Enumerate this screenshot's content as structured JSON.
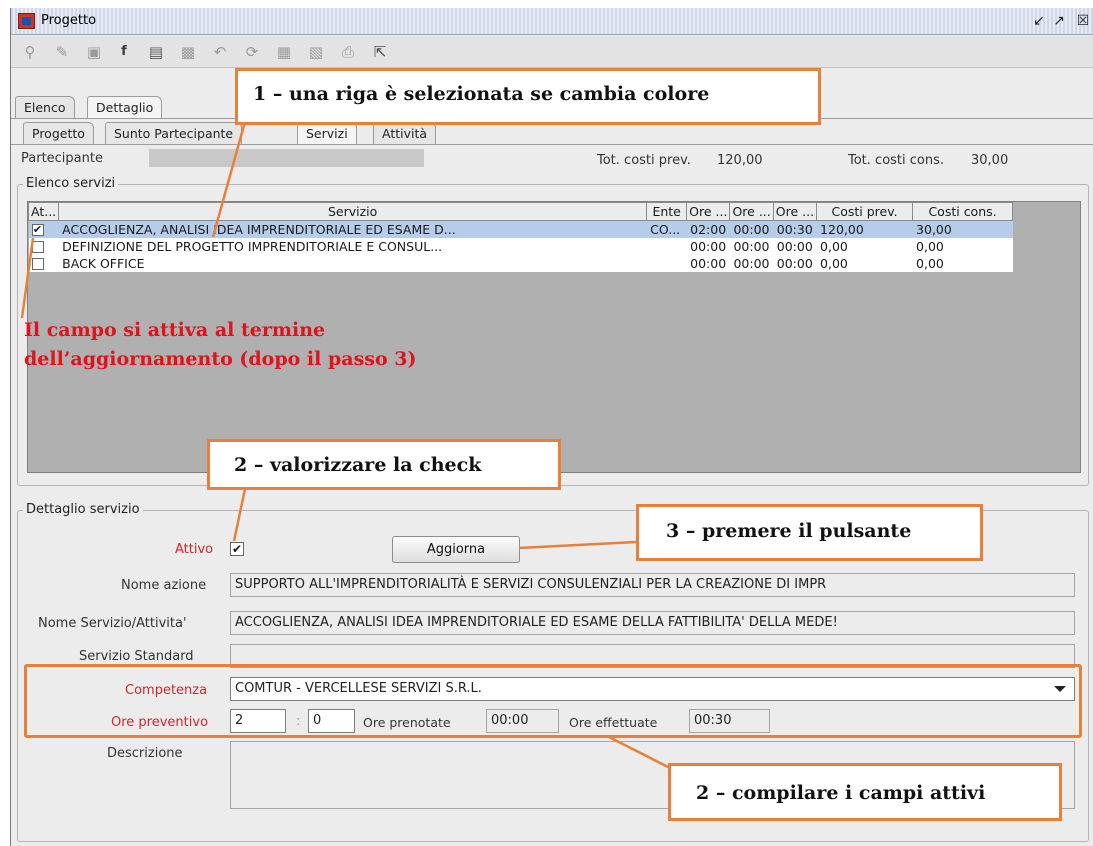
{
  "window": {
    "title": "Progetto",
    "controls": [
      "restore-icon",
      "maximize-icon",
      "close-icon"
    ]
  },
  "toolbar": {
    "icons": [
      "search-icon",
      "edit-icon",
      "document-icon",
      "fo-icon",
      "open-icon",
      "save-icon",
      "undo-icon",
      "refresh-icon",
      "lock-icon",
      "print-preview-icon",
      "print-icon",
      "export-icon"
    ]
  },
  "tabs_main": [
    "Elenco",
    "Dettaglio"
  ],
  "tabs_sub": [
    "Progetto",
    "Sunto Partecipante",
    "Servizi",
    "Attività"
  ],
  "header": {
    "participant_label": "Partecipante",
    "tot_prev_label": "Tot. costi prev.",
    "tot_prev_value": "120,00",
    "tot_cons_label": "Tot. costi cons.",
    "tot_cons_value": "30,00"
  },
  "services_group": {
    "title": "Elenco servizi",
    "columns": [
      "At...",
      "Servizio",
      "Ente",
      "Ore ...",
      "Ore ...",
      "Ore ...",
      "Costi prev.",
      "Costi cons."
    ],
    "rows": [
      {
        "checked": true,
        "servizio": "ACCOGLIENZA, ANALISI IDEA IMPRENDITORIALE ED ESAME D...",
        "ente": "CO...",
        "ore1": "02:00",
        "ore2": "00:00",
        "ore3": "00:30",
        "costi_prev": "120,00",
        "costi_cons": "30,00"
      },
      {
        "checked": false,
        "servizio": "DEFINIZIONE DEL PROGETTO IMPRENDITORIALE E CONSUL...",
        "ente": "",
        "ore1": "00:00",
        "ore2": "00:00",
        "ore3": "00:00",
        "costi_prev": "0,00",
        "costi_cons": "0,00"
      },
      {
        "checked": false,
        "servizio": "BACK OFFICE",
        "ente": "",
        "ore1": "00:00",
        "ore2": "00:00",
        "ore3": "00:00",
        "costi_prev": "0,00",
        "costi_cons": "0,00"
      }
    ]
  },
  "detail_group": {
    "title": "Dettaglio servizio",
    "attivo_label": "Attivo",
    "attivo_checked": true,
    "aggiorna_label": "Aggiorna",
    "nome_azione_label": "Nome azione",
    "nome_azione_value": "SUPPORTO ALL'IMPRENDITORIALITÀ E SERVIZI CONSULENZIALI PER LA CREAZIONE DI IMPR",
    "nome_servizio_label": "Nome Servizio/Attivita'",
    "nome_servizio_value": "ACCOGLIENZA, ANALISI IDEA IMPRENDITORIALE ED ESAME DELLA FATTIBILITA' DELLA MEDE!",
    "servizio_standard_label": "Servizio Standard",
    "servizio_standard_value": "",
    "competenza_label": "Competenza",
    "competenza_value": "COMTUR - VERCELLESE SERVIZI S.R.L.",
    "ore_preventivo_label": "Ore preventivo",
    "ore_prev_hours": "2",
    "ore_prev_sep": ":",
    "ore_prev_minutes": "0",
    "ore_prenotate_label": "Ore prenotate",
    "ore_prenotate_value": "00:00",
    "ore_effettuate_label": "Ore effettuate",
    "ore_effettuate_value": "00:30",
    "descrizione_label": "Descrizione",
    "descrizione_value": ""
  },
  "annotations": {
    "callout1": "1 – una riga è selezionata se cambia colore",
    "callout2a": "2 – valorizzare la check",
    "callout3": "3 – premere il pulsante",
    "callout2b": "2 – compilare i campi attivi",
    "note_line1": "Il campo si attiva al termine",
    "note_line2": "dell’aggiornamento (dopo il passo 3)",
    "accent_color": "#e8803a",
    "note_color": "#e0121a"
  }
}
